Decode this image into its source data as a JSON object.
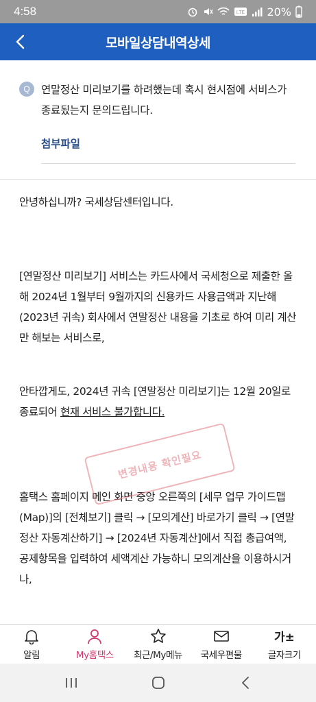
{
  "status_bar": {
    "time": "4:58",
    "battery": "20%"
  },
  "header": {
    "title": "모바일상담내역상세"
  },
  "question": {
    "badge": "Q",
    "text": "연말정산 미리보기를 하려했는데 혹시 현시점에 서비스가 종료됬는지 문의드립니다.",
    "attachment_label": "첨부파일"
  },
  "answer": {
    "greeting": "안녕하십니까? 국세상담센터입니다.",
    "paragraph1": "[연말정산 미리보기] 서비스는 카드사에서 국세청으로 제출한 올해 2024년 1월부터 9월까지의 신용카드 사용금액과 지난해 (2023년 귀속) 회사에서 연말정산 내용을 기초로 하여 미리 계산만 해보는 서비스로,",
    "paragraph2_before": "안타깝게도, 2024년 귀속 [연말정산 미리보기]는 12월 20일로 종료되어 ",
    "paragraph2_underline": "현재 서비스 불가합니다.",
    "paragraph3": "홈택스 홈페이지 메인 화면 중앙 오른쪽의 [세무 업무 가이드맵(Map)]의 [전체보기] 클릭 → [모의계산] 바로가기 클릭 → [연말정산 자동계산하기] → [2024년 자동계산]에서 직접 총급여액, 공제항목을 입력하여 세액계산 가능하니 모의계산을 이용하시거나,"
  },
  "stamp": {
    "text": "변경내용 확인필요"
  },
  "bottom_nav": {
    "items": [
      {
        "label": "알림",
        "icon": "bell-icon"
      },
      {
        "label": "My홈택스",
        "icon": "person-icon",
        "active": true
      },
      {
        "label": "최근/My메뉴",
        "icon": "star-icon"
      },
      {
        "label": "국세우편물",
        "icon": "mail-icon"
      },
      {
        "label": "글자크기",
        "icon": "font-size-icon",
        "glyph": "가±"
      }
    ]
  },
  "colors": {
    "header": "#1f5fbf",
    "active_nav": "#d0366f",
    "attachment": "#2a4d8a"
  }
}
